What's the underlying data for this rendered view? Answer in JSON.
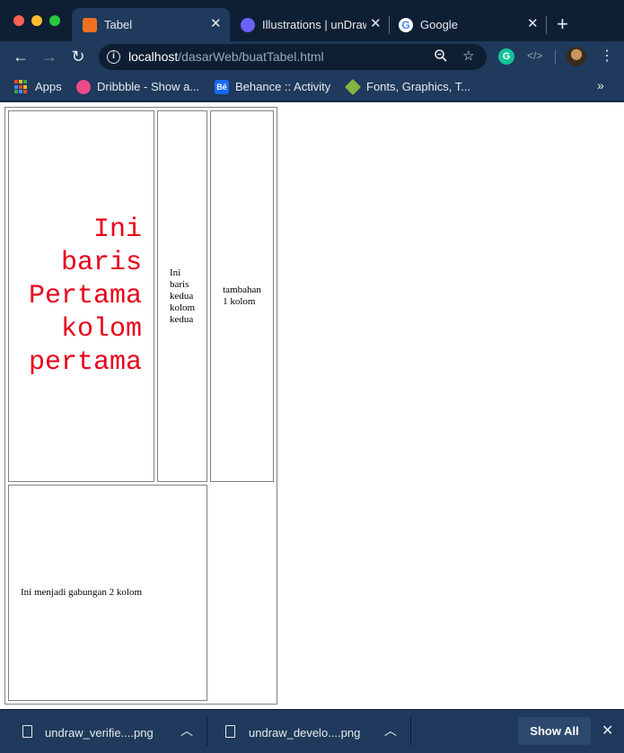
{
  "tabs": [
    {
      "title": "Tabel",
      "favicon": "xampp-icon",
      "color": "#f27021",
      "active": true
    },
    {
      "title": "Illustrations | unDraw",
      "favicon": "undraw-icon",
      "color": "#6c63ff",
      "active": false
    },
    {
      "title": "Google",
      "favicon": "google-icon",
      "color": "#4285f4",
      "active": false
    }
  ],
  "toolbar": {
    "url_host": "localhost",
    "url_path": "/dasarWeb/buatTabel.html"
  },
  "bookmarks": [
    {
      "label": "Apps",
      "icon": "apps-grid-icon"
    },
    {
      "label": "Dribbble - Show a...",
      "icon": "dribbble-icon",
      "color": "#ea4c89"
    },
    {
      "label": "Behance :: Activity",
      "icon": "behance-icon",
      "color": "#1769ff"
    },
    {
      "label": "Fonts, Graphics, T...",
      "icon": "tag-icon",
      "color": "#82b541"
    }
  ],
  "table": {
    "cell_1": "Ini baris Pertama kolom pertama",
    "cell_2": "Ini baris kedua kolom kedua",
    "cell_3": "tambahan 1 kolom",
    "cell_merge": "Ini menjadi gabungan 2 kolom",
    "accent_color": "#e8001a"
  },
  "downloads": {
    "items": [
      {
        "name": "undraw_verifie....png"
      },
      {
        "name": "undraw_develo....png"
      }
    ],
    "show_all": "Show All"
  }
}
